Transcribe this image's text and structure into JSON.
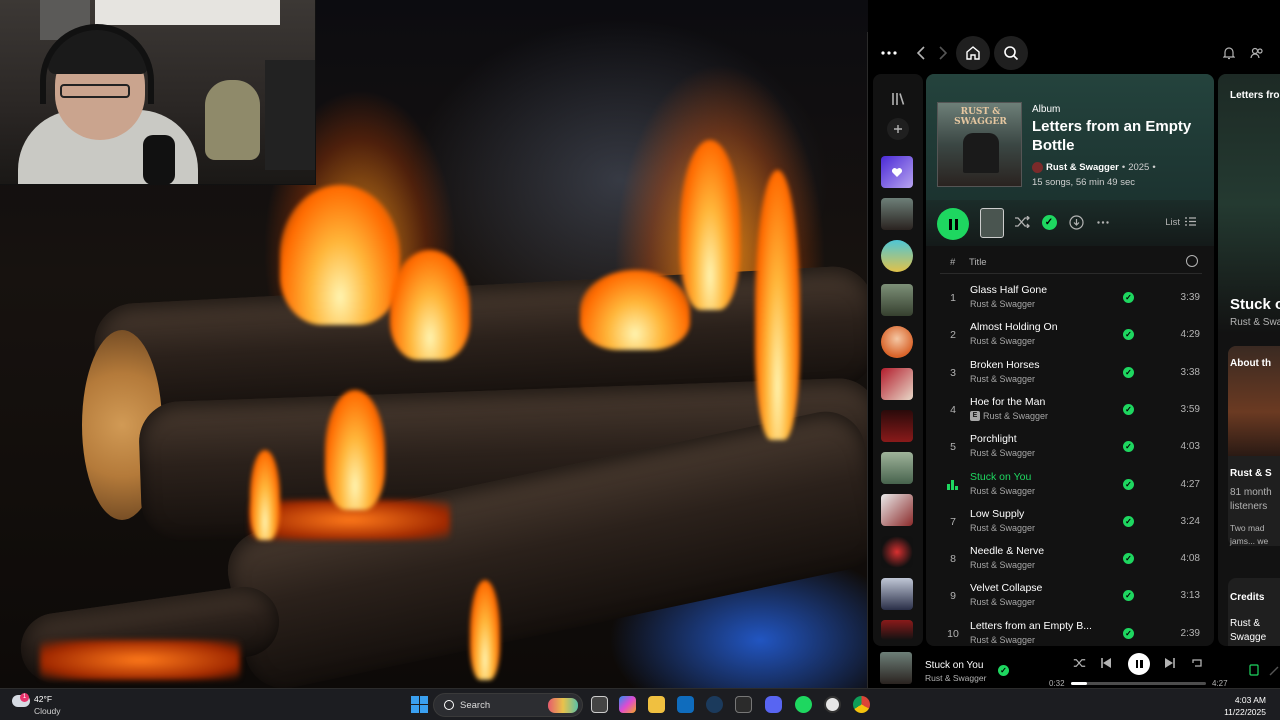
{
  "webcam": {},
  "spotify": {
    "topbar": {
      "more_icon": "more-horizontal-icon",
      "back_icon": "chevron-left-icon",
      "forward_icon": "chevron-right-icon",
      "home_icon": "home-icon",
      "search_icon": "search-icon",
      "bell_icon": "bell-icon",
      "friends_icon": "friends-icon"
    },
    "album": {
      "kind": "Album",
      "title": "Letters from an Empty Bottle",
      "artist": "Rust & Swagger",
      "year": "2025",
      "stats": "15 songs, 56 min 49 sec",
      "cover_text": "RUST & SWAGGER"
    },
    "actions": {
      "list_label": "List"
    },
    "track_header": {
      "num": "#",
      "title": "Title"
    },
    "tracks": [
      {
        "num": "1",
        "title": "Glass Half Gone",
        "artist": "Rust & Swagger",
        "duration": "3:39",
        "explicit": false,
        "playing": false
      },
      {
        "num": "2",
        "title": "Almost Holding On",
        "artist": "Rust & Swagger",
        "duration": "4:29",
        "explicit": false,
        "playing": false
      },
      {
        "num": "3",
        "title": "Broken Horses",
        "artist": "Rust & Swagger",
        "duration": "3:38",
        "explicit": false,
        "playing": false
      },
      {
        "num": "4",
        "title": "Hoe for the Man",
        "artist": "Rust & Swagger",
        "duration": "3:59",
        "explicit": true,
        "playing": false
      },
      {
        "num": "5",
        "title": "Porchlight",
        "artist": "Rust & Swagger",
        "duration": "4:03",
        "explicit": false,
        "playing": false
      },
      {
        "num": "6",
        "title": "Stuck on You",
        "artist": "Rust & Swagger",
        "duration": "4:27",
        "explicit": false,
        "playing": true
      },
      {
        "num": "7",
        "title": "Low Supply",
        "artist": "Rust & Swagger",
        "duration": "3:24",
        "explicit": false,
        "playing": false
      },
      {
        "num": "8",
        "title": "Needle & Nerve",
        "artist": "Rust & Swagger",
        "duration": "4:08",
        "explicit": false,
        "playing": false
      },
      {
        "num": "9",
        "title": "Velvet Collapse",
        "artist": "Rust & Swagger",
        "duration": "3:13",
        "explicit": false,
        "playing": false
      },
      {
        "num": "10",
        "title": "Letters from an Empty B...",
        "artist": "Rust & Swagger",
        "duration": "2:39",
        "explicit": false,
        "playing": false
      }
    ],
    "right_panel": {
      "header": "Letters fro",
      "song_title": "Stuck o",
      "song_artist": "Rust & Swa",
      "about_title": "About th",
      "artist_name": "Rust & S",
      "listeners_1": "81 month",
      "listeners_2": "listeners",
      "bio_1": "Two mad",
      "bio_2": "jams... we",
      "credits_title": "Credits",
      "credits_1": "Rust &",
      "credits_2": "Swagge"
    },
    "player": {
      "title": "Stuck on You",
      "artist": "Rust & Swagger",
      "elapsed": "0:32",
      "total": "4:27",
      "progress": 0.12
    }
  },
  "taskbar": {
    "weather_temp": "42°F",
    "weather_cond": "Cloudy",
    "weather_badge": "1",
    "search_label": "Search",
    "time": "4:03 AM",
    "date": "11/22/2025"
  },
  "colors": {
    "spotify_green": "#1ed760",
    "album_header": "#24433d"
  }
}
